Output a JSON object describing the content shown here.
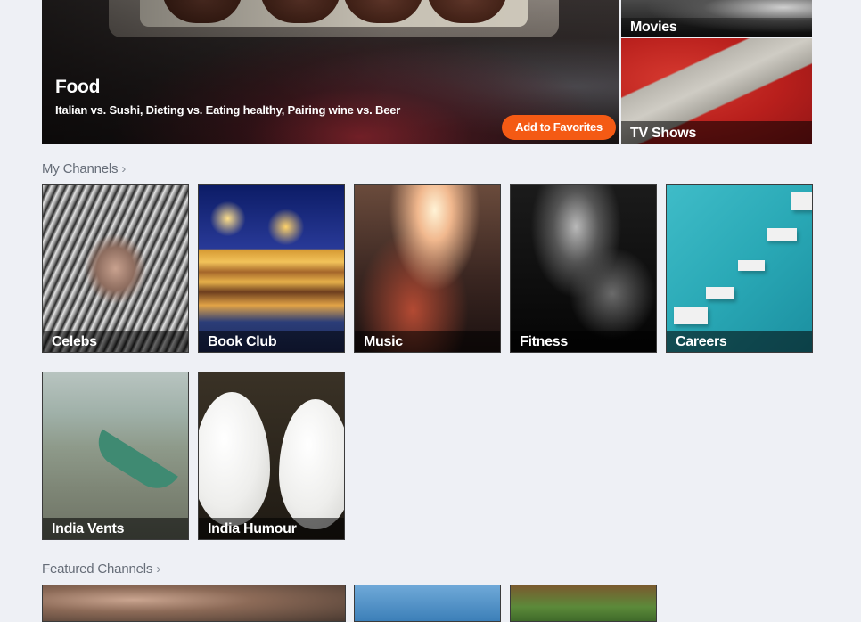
{
  "hero": {
    "title": "Food",
    "subtitle": "Italian vs. Sushi, Dieting vs. Eating healthy, Pairing wine vs. Beer",
    "favorite_button": "Add to Favorites",
    "accent_color": "#f45a14"
  },
  "side_tiles": [
    {
      "label": "Movies"
    },
    {
      "label": "TV Shows"
    }
  ],
  "my_channels": {
    "title": "My Channels",
    "tiles": [
      {
        "label": "Celebs"
      },
      {
        "label": "Book Club"
      },
      {
        "label": "Music"
      },
      {
        "label": "Fitness"
      },
      {
        "label": "Careers"
      },
      {
        "label": "India Vents"
      },
      {
        "label": "India Humour"
      }
    ]
  },
  "featured_channels": {
    "title": "Featured Channels"
  },
  "icons": {
    "chevron": "chevron-right-icon"
  }
}
